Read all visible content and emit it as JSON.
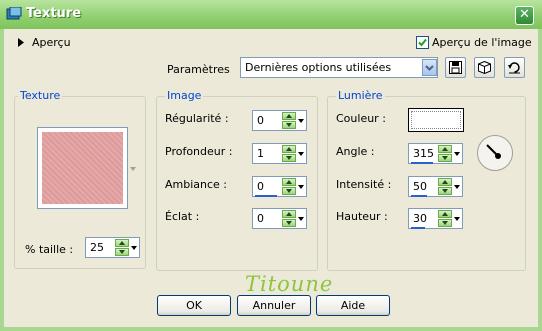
{
  "window": {
    "title": "Texture",
    "close_symbol": "✕"
  },
  "preview": {
    "toggle_label": "Aperçu",
    "checkbox_label": "Aperçu de l'image",
    "checkbox_checked": true
  },
  "presets": {
    "label": "Paramètres",
    "selected": "Dernières options utilisées"
  },
  "texture_group": {
    "title": "Texture",
    "size_label": "% taille :",
    "size_value": "25"
  },
  "image_group": {
    "title": "Image",
    "regularity_label": "Régularité :",
    "regularity_value": "0",
    "depth_label": "Profondeur :",
    "depth_value": "1",
    "ambiance_label": "Ambiance :",
    "ambiance_value": "0",
    "eclat_label": "Éclat :",
    "eclat_value": "0"
  },
  "light_group": {
    "title": "Lumière",
    "color_label": "Couleur :",
    "color_value": "#ffffff",
    "angle_label": "Angle :",
    "angle_value": "315",
    "intensity_label": "Intensité :",
    "intensity_value": "50",
    "height_label": "Hauteur :",
    "height_value": "30"
  },
  "watermark": "Titoune",
  "buttons": {
    "ok": "OK",
    "cancel": "Annuler",
    "help": "Aide"
  },
  "colors": {
    "title_bar": "#8fcf6e",
    "dialog_bg": "#ece9d8",
    "group_title": "#0046d5",
    "swatch": "#e3a8a8",
    "watermark": "#8cc63f"
  }
}
